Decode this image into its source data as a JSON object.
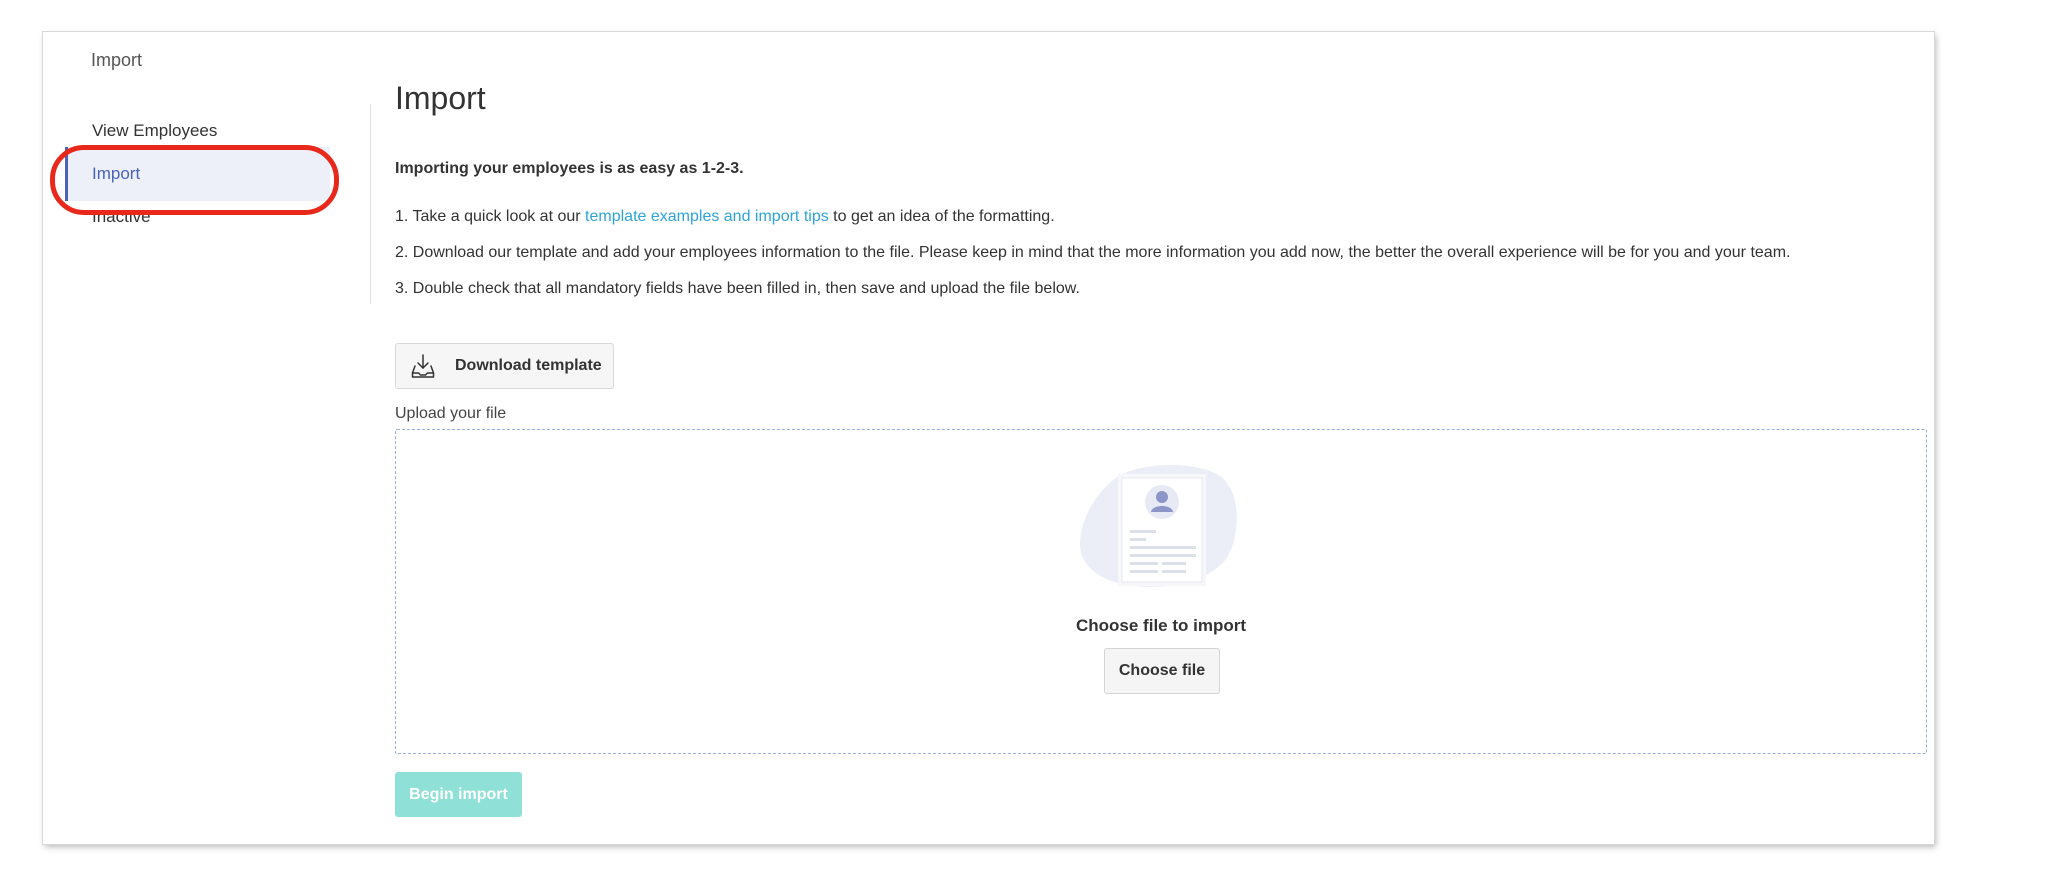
{
  "breadcrumb": "Import",
  "sidebar": {
    "items": [
      {
        "label": "View Employees",
        "active": false
      },
      {
        "label": "Import",
        "active": true
      },
      {
        "label": "Inactive",
        "active": false
      }
    ]
  },
  "main": {
    "title": "Import",
    "intro": "Importing your employees is as easy as 1-2-3.",
    "step1": {
      "before": "1. Take a quick look at our ",
      "link": "template examples and import tips",
      "after": " to get an idea of the formatting."
    },
    "step2": "2. Download our template and add your employees information to the file. Please keep in mind that the more information you add now, the better the overall experience will be for you and your team.",
    "step3": "3. Double check that all mandatory fields have been filled in, then save and upload the file below.",
    "download_button": "Download template",
    "upload_label": "Upload your file",
    "dropzone": {
      "title": "Choose file to import",
      "button": "Choose file"
    },
    "begin_button": "Begin import"
  },
  "colors": {
    "accent": "#4a62b8",
    "link": "#2da5d6",
    "highlight": "#e8281b",
    "begin_button_disabled": "#8fe0d6"
  },
  "icons": {
    "download": "download-tray-icon",
    "illustration": "document-profile-illustration"
  }
}
